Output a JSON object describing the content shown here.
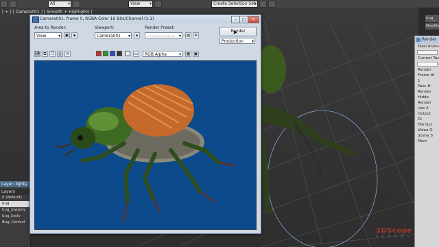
{
  "toolbar": {
    "filter_value": "All",
    "view_value": "View",
    "selection_set_placeholder": "Create Selection Set"
  },
  "viewport": {
    "label": "[ + ] [ Camera001 ] [ Smooth + Highlights ]",
    "watermark_main": "3DScope",
    "watermark_sub": "S C H O O L"
  },
  "layer_panel": {
    "title": "Layer: lights",
    "header": "Layers",
    "rows": [
      "0 (default)",
      "bug",
      "bug_lowpoly",
      "bug_body",
      "Bug_Control"
    ]
  },
  "command_panel": {
    "items": [
      "bug_",
      "Modifier",
      "Render"
    ]
  },
  "right_panel": {
    "title": "Rendering",
    "lines": [
      "Total Animation",
      "Current Task:",
      "Render",
      "Frame #:",
      "1",
      "Pass #:",
      "Render",
      "Hidde",
      "Render",
      "Use A",
      "Output",
      "Di",
      "File Out",
      "Video O",
      "Scene S",
      "Mem"
    ]
  },
  "render_window": {
    "title": "Camera001, frame 0, RGBA Color 16 Bits/Channel (1:1)",
    "area_label": "Area to Render:",
    "area_value": "View",
    "viewport_label": "Viewport:",
    "viewport_value": "Camera001",
    "preset_label": "Render Preset:",
    "preset_value": "-------------------",
    "render_button": "Render",
    "production_value": "Production",
    "channel_value": "RGB Alpha",
    "window_buttons": {
      "minimize": "–",
      "maximize": "□",
      "close": "✕"
    }
  },
  "colors": {
    "render_bg": "#0c4a8c",
    "title_bar": "#c9d6e4",
    "channel_red": "#d22a2a",
    "channel_green": "#2a9a2a",
    "channel_blue": "#2a4ad2"
  }
}
